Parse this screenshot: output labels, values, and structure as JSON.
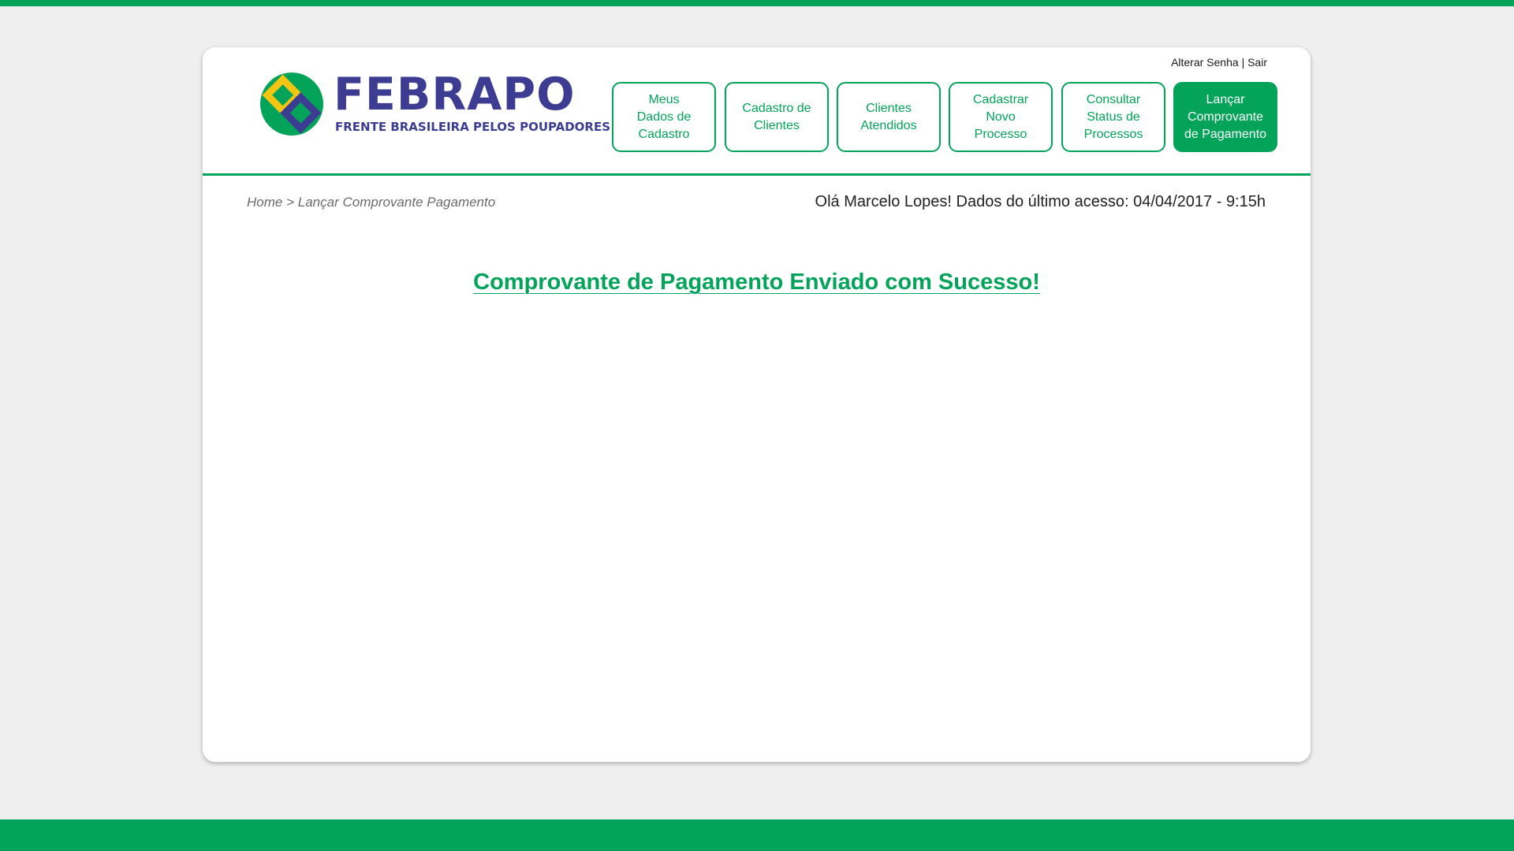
{
  "brand": {
    "name": "FEBRAPO",
    "tagline": "FRENTE BRASILEIRA PELOS POUPADORES",
    "colors": {
      "green": "#04a35a",
      "navy": "#3c3d92",
      "yellow": "#f2c512"
    }
  },
  "top_links": {
    "change_password": "Alterar Senha",
    "separator": "|",
    "logout": "Sair"
  },
  "nav": {
    "items": [
      {
        "label": "Meus\nDados de\nCadastro",
        "active": false
      },
      {
        "label": "Cadastro de\nClientes",
        "active": false
      },
      {
        "label": "Clientes\nAtendidos",
        "active": false
      },
      {
        "label": "Cadastrar\nNovo\nProcesso",
        "active": false
      },
      {
        "label": "Consultar\nStatus de\nProcessos",
        "active": false
      },
      {
        "label": "Lançar\nComprovante\nde Pagamento",
        "active": true
      }
    ]
  },
  "breadcrumb": {
    "home": "Home",
    "separator": ">",
    "current": "Lançar Comprovante Pagamento"
  },
  "greeting": "Olá Marcelo Lopes! Dados do último acesso: 04/04/2017 - 9:15h",
  "main": {
    "success_message": "Comprovante de Pagamento Enviado com Sucesso!"
  }
}
